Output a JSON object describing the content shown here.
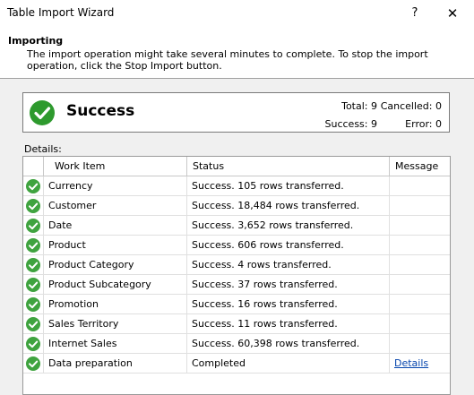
{
  "window": {
    "title": "Table Import Wizard",
    "help_glyph": "?",
    "close_glyph": "✕"
  },
  "header": {
    "title": "Importing",
    "description": "The import operation might take several minutes to complete. To stop the import operation, click the Stop Import button."
  },
  "summary": {
    "status": "Success",
    "total_label": "Total:",
    "total": "9",
    "cancelled_label": "Cancelled:",
    "cancelled": "0",
    "success_label": "Success:",
    "success": "9",
    "error_label": "Error:",
    "error": "0"
  },
  "details": {
    "label": "Details:",
    "columns": [
      "Work Item",
      "Status",
      "Message"
    ],
    "rows": [
      {
        "item": "Currency",
        "status": "Success. 105 rows transferred.",
        "message": ""
      },
      {
        "item": "Customer",
        "status": "Success. 18,484 rows transferred.",
        "message": ""
      },
      {
        "item": "Date",
        "status": "Success. 3,652 rows transferred.",
        "message": ""
      },
      {
        "item": "Product",
        "status": "Success. 606 rows transferred.",
        "message": ""
      },
      {
        "item": "Product Category",
        "status": "Success. 4 rows transferred.",
        "message": ""
      },
      {
        "item": "Product Subcategory",
        "status": "Success. 37 rows transferred.",
        "message": ""
      },
      {
        "item": "Promotion",
        "status": "Success. 16 rows transferred.",
        "message": ""
      },
      {
        "item": "Sales Territory",
        "status": "Success. 11 rows transferred.",
        "message": ""
      },
      {
        "item": "Internet Sales",
        "status": "Success. 60,398 rows transferred.",
        "message": ""
      },
      {
        "item": "Data preparation",
        "status": "Completed",
        "message": "Details"
      }
    ]
  },
  "icons": {
    "row_status": "check-circle-icon",
    "summary_status": "check-circle-icon"
  },
  "colors": {
    "success_green": "#2e9a2e",
    "link": "#0645ad"
  }
}
